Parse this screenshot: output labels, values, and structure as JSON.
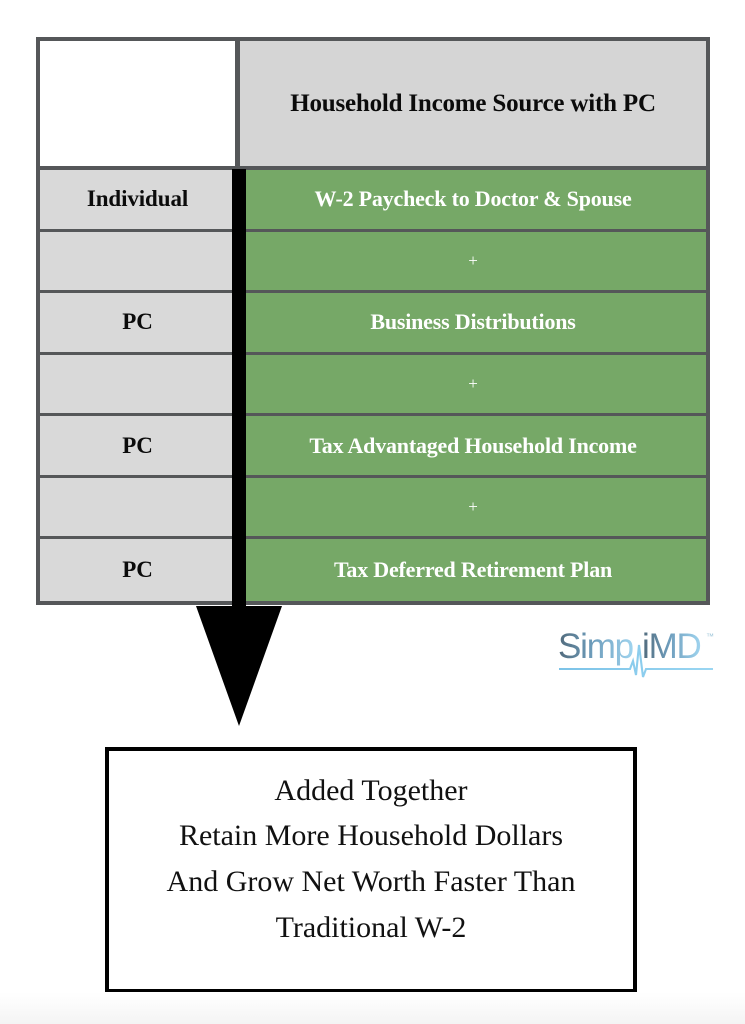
{
  "table": {
    "header": {
      "blank_label": "",
      "title": "Household Income Source with PC",
      "title_line1": "Household Income Source",
      "title_line2": "with PC"
    },
    "rows": [
      {
        "entity": "Individual",
        "source": "W-2 Paycheck to Doctor & Spouse",
        "is_operator": false
      },
      {
        "entity": "",
        "source": "+",
        "is_operator": true
      },
      {
        "entity": "PC",
        "source": "Business Distributions",
        "is_operator": false
      },
      {
        "entity": "",
        "source": "+",
        "is_operator": true
      },
      {
        "entity": "PC",
        "source": "Tax Advantaged Household Income",
        "is_operator": false
      },
      {
        "entity": "",
        "source": "+",
        "is_operator": true
      },
      {
        "entity": "PC",
        "source": "Tax Deferred Retirement Plan",
        "is_operator": false
      }
    ]
  },
  "arrow": {
    "icon": "down-arrow-icon",
    "color": "#000000"
  },
  "brand": {
    "icon": "simplimd-logo",
    "name": "SimpliMD",
    "name_part1": "Simp",
    "name_part2": "iMD",
    "trademark": "™",
    "color_dark": "#4a6070",
    "color_light": "#7ec8ef",
    "underline_color": "#76c4ec"
  },
  "summary": {
    "lines": [
      "Added Together",
      "Retain More Household Dollars",
      "And Grow Net Worth Faster Than",
      "Traditional W-2"
    ],
    "line1": "Added Together",
    "line2": "Retain More Household Dollars",
    "line3": "And Grow Net Worth Faster Than",
    "line4": "Traditional W-2"
  },
  "colors": {
    "green_cell": "#74a764",
    "gray_cell": "#d9d9d9",
    "gray_header": "#d5d5d5",
    "border": "#555759",
    "black": "#000000"
  }
}
